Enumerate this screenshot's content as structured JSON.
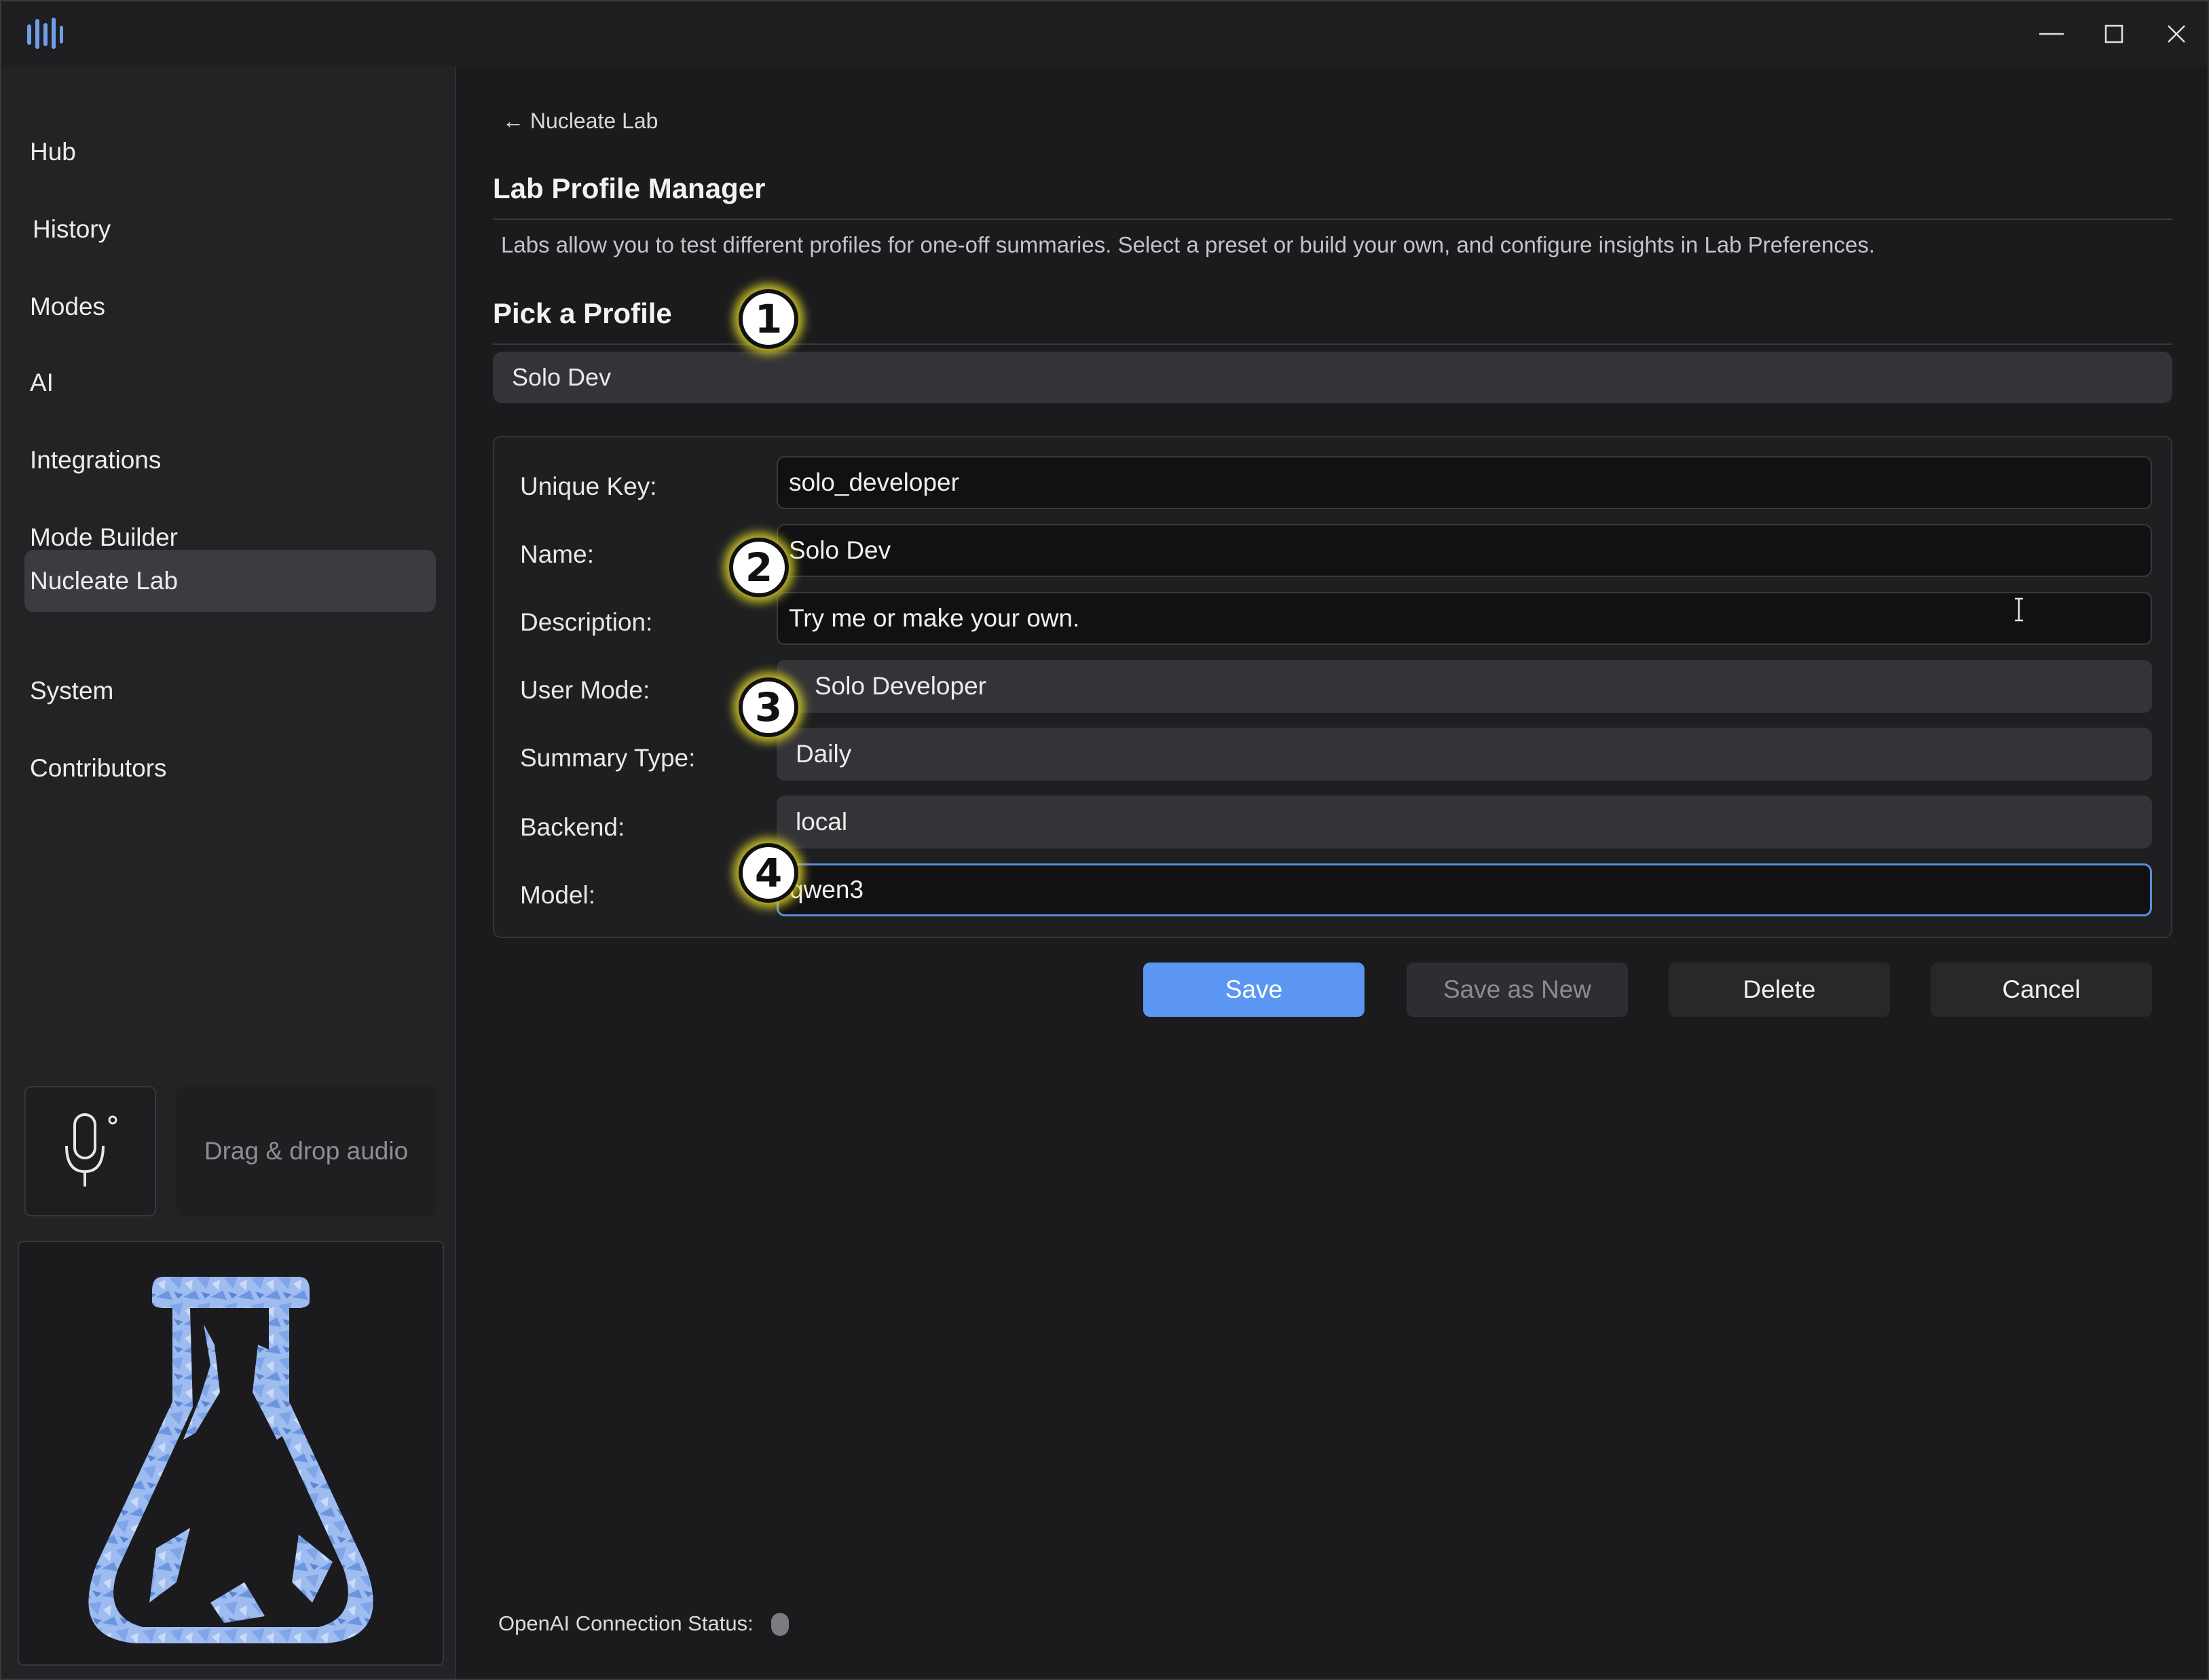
{
  "sidebar": {
    "items": [
      {
        "label": "Hub"
      },
      {
        "label": "History"
      },
      {
        "label": "Modes"
      },
      {
        "label": "AI"
      },
      {
        "label": "Integrations"
      },
      {
        "label": "Mode Builder"
      },
      {
        "label": "Nucleate Lab",
        "active": true
      },
      {
        "label": "System"
      },
      {
        "label": "Contributors"
      }
    ],
    "dropzone_label": "Drag & drop audio"
  },
  "main": {
    "back_link": "← Nucleate Lab",
    "title": "Lab Profile Manager",
    "intro": "Labs allow you to test different profiles for one-off summaries. Select a preset or build your own, and configure insights in Lab Preferences.",
    "pick_profile_title": "Pick a Profile",
    "selected_profile": "Solo Dev",
    "form": {
      "unique_key": {
        "label": "Unique Key:",
        "value": "solo_developer"
      },
      "name": {
        "label": "Name:",
        "value": "Solo Dev"
      },
      "description": {
        "label": "Description:",
        "value": "Try me or make your own."
      },
      "user_mode": {
        "label": "User Mode:",
        "value": "Solo Developer"
      },
      "summary_type": {
        "label": "Summary Type:",
        "value": "Daily"
      },
      "backend": {
        "label": "Backend:",
        "value": "local"
      },
      "model": {
        "label": "Model:",
        "value": "qwen3"
      }
    },
    "buttons": {
      "save": "Save",
      "save_as_new": "Save as New",
      "delete": "Delete",
      "cancel": "Cancel"
    },
    "status_label": "OpenAI Connection Status:"
  },
  "markers": [
    "1",
    "2",
    "3",
    "4"
  ],
  "colors": {
    "accent": "#5a96f2",
    "focus_border": "#5b8fd9",
    "marker_glow": "#dcd228",
    "status_dot": "#7c7c80"
  }
}
